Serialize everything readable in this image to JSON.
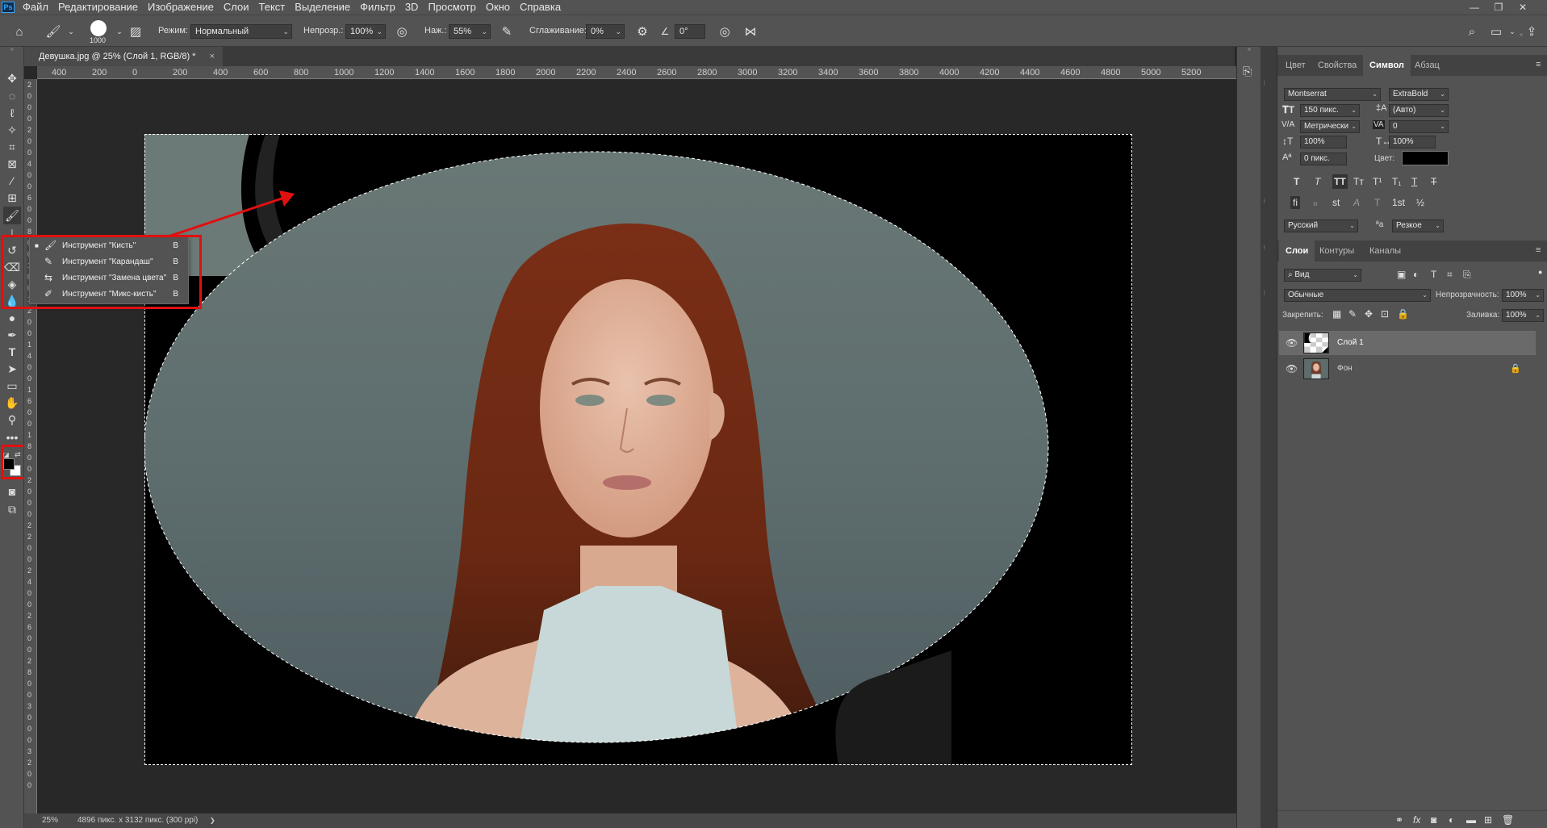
{
  "app": {
    "logo": "Ps"
  },
  "menu": [
    "Файл",
    "Редактирование",
    "Изображение",
    "Слои",
    "Текст",
    "Выделение",
    "Фильтр",
    "3D",
    "Просмотр",
    "Окно",
    "Справка"
  ],
  "window_controls": {
    "minimize": "—",
    "restore": "❐",
    "close": "✕"
  },
  "options": {
    "brush_size": "1000",
    "mode_label": "Режим:",
    "mode_value": "Нормальный",
    "opacity_label": "Непрозр.:",
    "opacity_value": "100%",
    "flow_label": "Наж.:",
    "flow_value": "55%",
    "smoothing_label": "Сглаживание:",
    "smoothing_value": "0%",
    "angle_value": "0°"
  },
  "document_tab": {
    "title": "Девушка.jpg @ 25% (Слой 1, RGB/8) *",
    "close": "×"
  },
  "ruler": {
    "top": [
      "400",
      "200",
      "0",
      "200",
      "400",
      "600",
      "800",
      "1000",
      "1200",
      "1400",
      "1600",
      "1800",
      "2000",
      "2200",
      "2400",
      "2600",
      "2800",
      "3000",
      "3200",
      "3400",
      "3600",
      "3800",
      "4000",
      "4200",
      "4400",
      "4600",
      "4800",
      "5000",
      "5200"
    ],
    "left": [
      "2",
      "0",
      "0",
      "0",
      "2",
      "0",
      "0",
      "4",
      "0",
      "0",
      "6",
      "0",
      "0",
      "8",
      "0",
      "0",
      "1",
      "0",
      "0",
      "1",
      "2",
      "0",
      "0",
      "1",
      "4",
      "0",
      "0",
      "1",
      "6",
      "0",
      "0",
      "1",
      "8",
      "0",
      "0",
      "2",
      "0",
      "0",
      "0",
      "2",
      "2",
      "0",
      "0",
      "2",
      "4",
      "0",
      "0",
      "2",
      "6",
      "0",
      "0",
      "2",
      "8",
      "0",
      "0",
      "3",
      "0",
      "0",
      "0",
      "3",
      "2",
      "0",
      "0"
    ]
  },
  "status": {
    "zoom": "25%",
    "info": "4896 пикс. x 3132 пикс. (300 ppi)",
    "arrow": "❯"
  },
  "brush_flyout": {
    "items": [
      {
        "label": "Инструмент \"Кисть\"",
        "key": "B",
        "selected": true,
        "icon": "brush-icon"
      },
      {
        "label": "Инструмент \"Карандаш\"",
        "key": "B",
        "selected": false,
        "icon": "pencil-icon"
      },
      {
        "label": "Инструмент \"Замена цвета\"",
        "key": "B",
        "selected": false,
        "icon": "color-replacement-icon"
      },
      {
        "label": "Инструмент \"Микс-кисть\"",
        "key": "B",
        "selected": false,
        "icon": "mixer-brush-icon"
      }
    ]
  },
  "panels": {
    "top_tabs": [
      "Цвет",
      "Свойства",
      "Символ",
      "Абзац"
    ],
    "active_top_tab": "Символ",
    "character": {
      "font_family": "Montserrat",
      "font_style": "ExtraBold",
      "font_size": "150 пикс.",
      "leading": "(Авто)",
      "kerning": "Метрически",
      "tracking": "0",
      "vertical_scale": "100%",
      "horizontal_scale": "100%",
      "baseline_shift": "0 пикс.",
      "color_label": "Цвет:",
      "language": "Русский",
      "aa_label": "ªa",
      "antialias": "Резкое",
      "style_buttons": [
        "T",
        "T",
        "TT",
        "Tт",
        "T¹",
        "T₁",
        "T",
        "T"
      ],
      "opentype_buttons": [
        "fi",
        "ℴ",
        "st",
        "A",
        "T",
        "1st",
        "½"
      ]
    },
    "layer_tabs": [
      "Слои",
      "Контуры",
      "Каналы"
    ],
    "active_layer_tab": "Слои",
    "layers": {
      "filter_kind": "Вид",
      "blend_mode": "Обычные",
      "opacity_label": "Непрозрачность:",
      "opacity_value": "100%",
      "lock_label": "Закрепить:",
      "fill_label": "Заливка:",
      "fill_value": "100%",
      "items": [
        {
          "name": "Слой 1",
          "selected": true,
          "locked": false
        },
        {
          "name": "Фон",
          "selected": false,
          "locked": true
        }
      ],
      "footer_icons": [
        "link-icon",
        "fx-icon",
        "mask-icon",
        "adjustment-icon",
        "group-icon",
        "new-layer-icon",
        "trash-icon"
      ],
      "fx_label": "fx"
    }
  },
  "colors": {
    "foreground": "#000000",
    "background": "#ffffff",
    "highlight": "#e01010"
  }
}
